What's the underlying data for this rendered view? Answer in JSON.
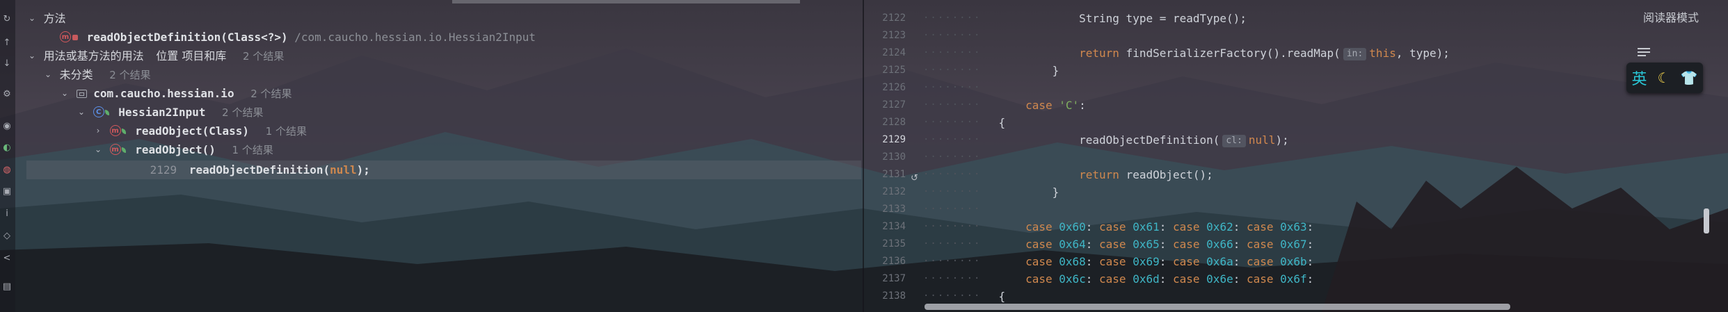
{
  "tree": {
    "methods_group": "方法",
    "target_method": "readObjectDefinition(Class<?>)",
    "target_path": "/com.caucho.hessian.io.Hessian2Input",
    "usages_group": "用法或基方法的用法",
    "usages_location": "位置 项目和库",
    "usages_count": "2 个结果",
    "uncategorized": "未分类",
    "uncategorized_count": "2 个结果",
    "package": "com.caucho.hessian.io",
    "package_count": "2 个结果",
    "class_name": "Hessian2Input",
    "class_count": "2 个结果",
    "m1_name": "readObject(Class)",
    "m1_count": "1 个结果",
    "m2_name": "readObject()",
    "m2_count": "1 个结果",
    "usage_line": "2129",
    "usage_call": "readObjectDefinition(",
    "usage_null": "null",
    "usage_end": ");"
  },
  "editor": {
    "lines": [
      {
        "n": "2122",
        "pre": "    String type = readType();"
      },
      {
        "n": "2123",
        "pre": ""
      },
      {
        "n": "2124",
        "kw": "    return ",
        "mid": "findSerializerFactory().readMap(",
        "hint": "in:",
        "kw2": "this",
        "post": ", type);"
      },
      {
        "n": "2125",
        "pre": "}"
      },
      {
        "n": "2126",
        "pre": ""
      },
      {
        "n": "2127",
        "kw": "case ",
        "str": "'C'",
        "post": ":"
      },
      {
        "n": "2128",
        "pre": "{"
      },
      {
        "n": "2129",
        "pre": "    readObjectDefinition(",
        "hint": "cl:",
        "kw2": "null",
        "post": ");"
      },
      {
        "n": "2130",
        "pre": ""
      },
      {
        "n": "2131",
        "kw": "    return ",
        "post": "readObject();"
      },
      {
        "n": "2132",
        "pre": "}"
      },
      {
        "n": "2133",
        "pre": ""
      },
      {
        "n": "2134",
        "cases": [
          "0x60",
          "0x61",
          "0x62",
          "0x63"
        ]
      },
      {
        "n": "2135",
        "cases": [
          "0x64",
          "0x65",
          "0x66",
          "0x67"
        ]
      },
      {
        "n": "2136",
        "cases": [
          "0x68",
          "0x69",
          "0x6a",
          "0x6b"
        ]
      },
      {
        "n": "2137",
        "cases": [
          "0x6c",
          "0x6d",
          "0x6e",
          "0x6f"
        ]
      },
      {
        "n": "2138",
        "pre": "{"
      }
    ],
    "case_kw": "case"
  },
  "reader_mode": "阅读器模式",
  "ime": {
    "lang": "英"
  },
  "colors": {
    "keyword": "#d0884e",
    "number": "#3fb6c6",
    "string": "#7fae5f",
    "accent": "#29c8d8"
  },
  "icons": [
    "refresh-icon",
    "arrow-up-icon",
    "settings-icon",
    "eye-icon",
    "method-icon",
    "class-icon",
    "package-icon",
    "wrap-icon",
    "moon-icon",
    "shirt-icon"
  ]
}
